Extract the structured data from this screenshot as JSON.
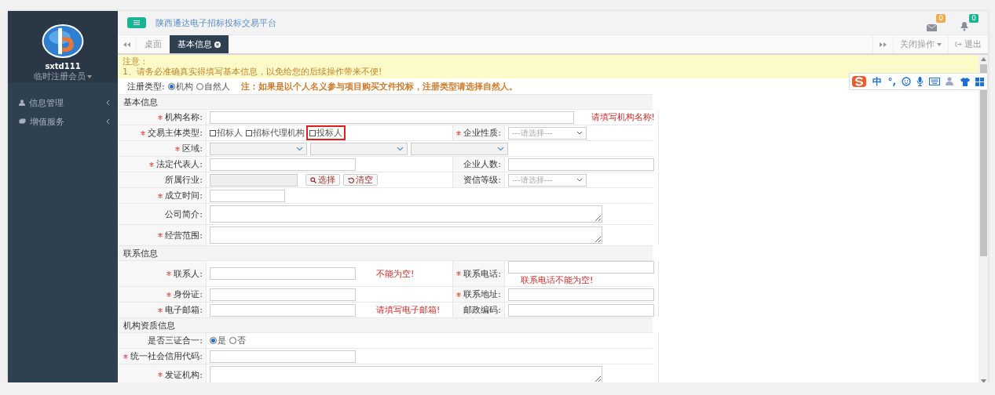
{
  "sidebar": {
    "username": "sxtd111",
    "role": "临时注册会员",
    "menu": [
      {
        "label": "信息管理",
        "kind": "user"
      },
      {
        "label": "增值服务",
        "kind": "stack"
      }
    ]
  },
  "topbar": {
    "title": "陕西通达电子招标投标交易平台",
    "notifications": [
      {
        "kind": "mail",
        "count": "0",
        "color": "#f0ad4e"
      },
      {
        "kind": "bell",
        "count": "0",
        "color": "#1ab394"
      }
    ]
  },
  "tabbar": {
    "tabs": [
      {
        "label": "桌面",
        "selected": false,
        "closable": false
      },
      {
        "label": "基本信息",
        "selected": true,
        "closable": true
      }
    ],
    "close_menu": "关闭操作",
    "logout": "退出"
  },
  "notice": {
    "title": "注意：",
    "lines": [
      "1、请务必准确真实得填写基本信息，以免给您的后续操作带来不便!"
    ]
  },
  "ime_toolbar": {
    "mode": "中",
    "punctuation": "°,"
  },
  "registration": {
    "label": "注册类型:",
    "options": [
      {
        "label": "机构",
        "selected": true
      },
      {
        "label": "自然人",
        "selected": false
      }
    ],
    "note": "注：如果是以个人名义参与项目购买文件投标，注册类型请选择自然人。"
  },
  "form": [
    {
      "kind": "section",
      "title": "基本信息"
    },
    {
      "kind": "field",
      "required": true,
      "label": "机构名称:",
      "control": {
        "kind": "wide"
      },
      "error": "请填写机构名称!"
    },
    {
      "kind": "field",
      "required": true,
      "label": "交易主体类型:",
      "control": {
        "kind": "checks",
        "options": [
          {
            "label": "招标人",
            "checked": false,
            "highlighted": false
          },
          {
            "label": "招标代理机构",
            "checked": false,
            "highlighted": false
          },
          {
            "label": "投标人",
            "checked": false,
            "highlighted": true
          }
        ]
      },
      "right": {
        "required": true,
        "label": "企业性质:",
        "control": {
          "kind": "select",
          "placeholder": "---请选择---"
        }
      }
    },
    {
      "kind": "field",
      "required": true,
      "label": "区域:",
      "control": {
        "kind": "region"
      }
    },
    {
      "kind": "field",
      "required": true,
      "label": "法定代表人:",
      "control": {
        "kind": "text"
      },
      "right": {
        "required": false,
        "label": "企业人数:",
        "control": {
          "kind": "text"
        }
      }
    },
    {
      "kind": "field",
      "required": false,
      "label": "所属行业:",
      "control": {
        "kind": "industry",
        "buttons": [
          {
            "label": "选择",
            "kind": "search"
          },
          {
            "label": "清空",
            "kind": "reset"
          }
        ]
      },
      "right": {
        "required": false,
        "label": "资信等级:",
        "control": {
          "kind": "select",
          "placeholder": "---请选择---"
        }
      }
    },
    {
      "kind": "field",
      "required": true,
      "label": "成立时间:",
      "control": {
        "kind": "date"
      }
    },
    {
      "kind": "field",
      "required": false,
      "label": "公司简介:",
      "control": {
        "kind": "textarea"
      }
    },
    {
      "kind": "field",
      "required": true,
      "label": "经营范围:",
      "control": {
        "kind": "textarea"
      }
    },
    {
      "kind": "section",
      "title": "联系信息"
    },
    {
      "kind": "field",
      "required": true,
      "label": "联系人:",
      "control": {
        "kind": "text"
      },
      "error": "不能为空!",
      "right": {
        "required": true,
        "label": "联系电话:",
        "control": {
          "kind": "text"
        },
        "error": "联系电话不能为空!"
      }
    },
    {
      "kind": "field",
      "required": true,
      "label": "身份证:",
      "control": {
        "kind": "text"
      },
      "right": {
        "required": true,
        "label": "联系地址:",
        "control": {
          "kind": "text"
        }
      }
    },
    {
      "kind": "field",
      "required": true,
      "label": "电子邮箱:",
      "control": {
        "kind": "text"
      },
      "error": "请填写电子邮箱!",
      "right": {
        "required": false,
        "label": "邮政编码:",
        "control": {
          "kind": "text"
        }
      }
    },
    {
      "kind": "section",
      "title": "机构资质信息"
    },
    {
      "kind": "field",
      "required": false,
      "label": "是否三证合一:",
      "control": {
        "kind": "radios",
        "options": [
          {
            "label": "是",
            "selected": true
          },
          {
            "label": "否",
            "selected": false
          }
        ]
      }
    },
    {
      "kind": "field",
      "required": true,
      "label": "统一社会信用代码:",
      "control": {
        "kind": "text"
      }
    },
    {
      "kind": "field",
      "required": true,
      "label": "发证机构:",
      "control": {
        "kind": "textarea"
      }
    }
  ]
}
